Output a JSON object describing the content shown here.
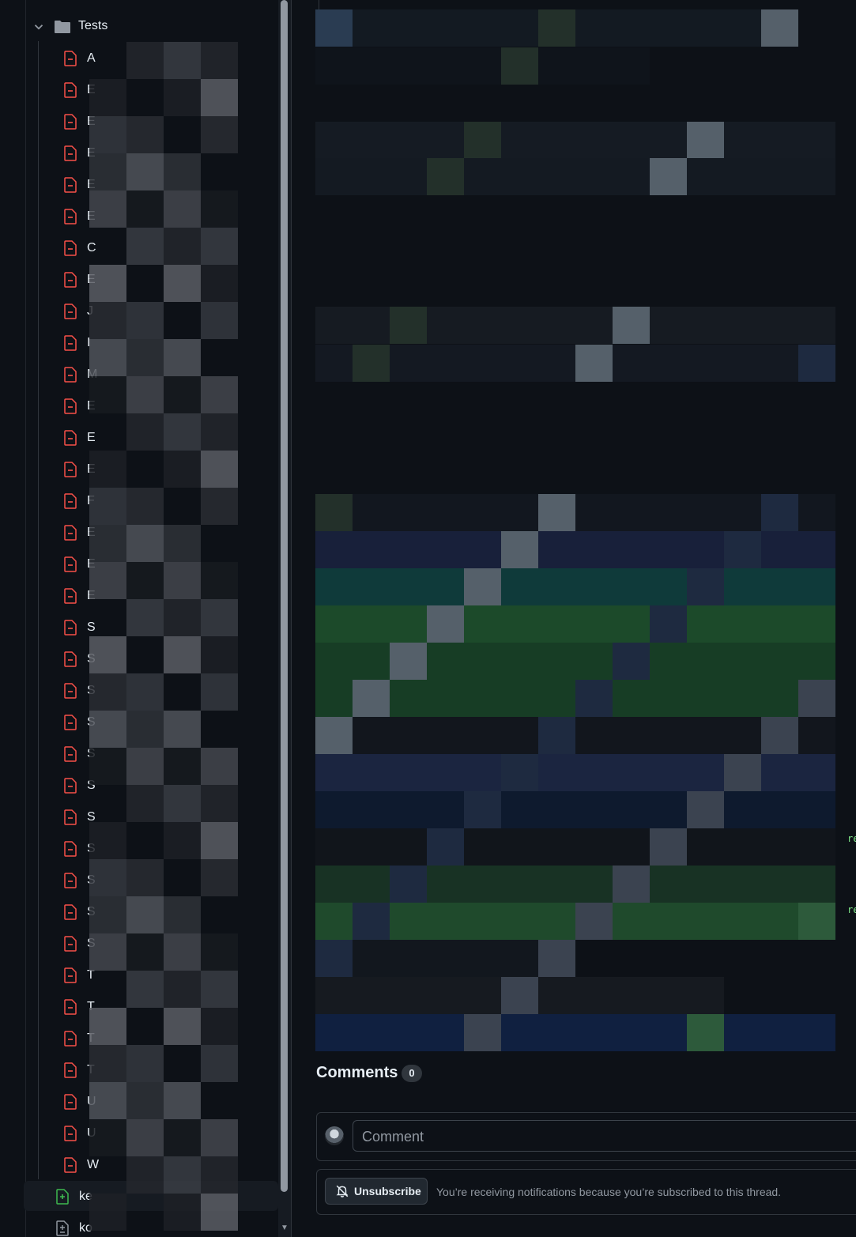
{
  "sidebar": {
    "folder_label": "Tests",
    "files": [
      {
        "initial": "A",
        "status": "deleted"
      },
      {
        "initial": "E",
        "status": "deleted"
      },
      {
        "initial": "E",
        "status": "deleted"
      },
      {
        "initial": "E",
        "status": "deleted"
      },
      {
        "initial": "E",
        "status": "deleted"
      },
      {
        "initial": "E",
        "status": "deleted"
      },
      {
        "initial": "C",
        "status": "deleted"
      },
      {
        "initial": "E",
        "status": "deleted"
      },
      {
        "initial": "J",
        "status": "deleted"
      },
      {
        "initial": "I",
        "status": "deleted"
      },
      {
        "initial": "M",
        "status": "deleted"
      },
      {
        "initial": "E",
        "status": "deleted"
      },
      {
        "initial": "E",
        "status": "deleted"
      },
      {
        "initial": "E",
        "status": "deleted"
      },
      {
        "initial": "F",
        "status": "deleted"
      },
      {
        "initial": "E",
        "status": "deleted"
      },
      {
        "initial": "E",
        "status": "deleted"
      },
      {
        "initial": "E",
        "status": "deleted"
      },
      {
        "initial": "S",
        "status": "deleted"
      },
      {
        "initial": "S",
        "status": "deleted"
      },
      {
        "initial": "S",
        "status": "deleted"
      },
      {
        "initial": "S",
        "status": "deleted"
      },
      {
        "initial": "S",
        "status": "deleted"
      },
      {
        "initial": "S",
        "status": "deleted"
      },
      {
        "initial": "S",
        "status": "deleted"
      },
      {
        "initial": "S",
        "status": "deleted"
      },
      {
        "initial": "S",
        "status": "deleted"
      },
      {
        "initial": "S",
        "status": "deleted"
      },
      {
        "initial": "S",
        "status": "deleted"
      },
      {
        "initial": "T",
        "status": "deleted"
      },
      {
        "initial": "T",
        "status": "deleted"
      },
      {
        "initial": "T",
        "status": "deleted"
      },
      {
        "initial": "T",
        "status": "deleted"
      },
      {
        "initial": "U",
        "status": "deleted"
      },
      {
        "initial": "U",
        "status": "deleted"
      },
      {
        "initial": "W",
        "status": "deleted"
      }
    ],
    "bottom_files": [
      {
        "initial": "ke",
        "status": "added"
      },
      {
        "initial": "ko",
        "status": "modified"
      }
    ]
  },
  "comments": {
    "title": "Comments",
    "count": "0",
    "placeholder": "Comment",
    "unsubscribe_label": "Unsubscribe",
    "notification_text": "You’re receiving notifications because you’re subscribed to this thread."
  },
  "code_fragments": [
    "re",
    "re"
  ],
  "colors": {
    "deleted": "#f85149",
    "added": "#3fb950",
    "modified": "#9198a1",
    "background": "#0d1117"
  }
}
